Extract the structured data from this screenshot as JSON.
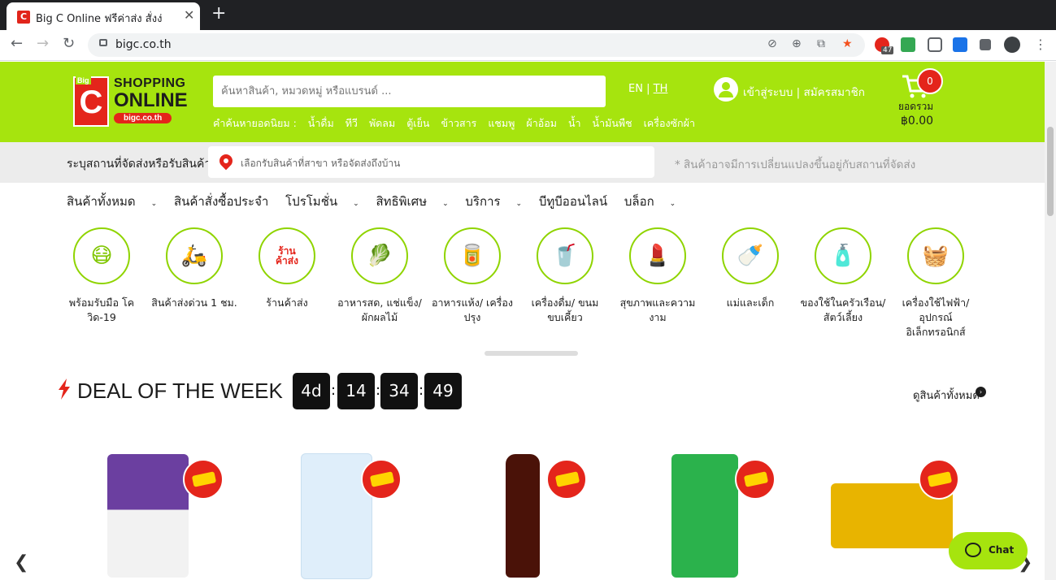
{
  "browser": {
    "tab_title": "Big C Online ฟรีค่าส่ง สั่งง่",
    "url": "bigc.co.th",
    "extension_badge": "47"
  },
  "header": {
    "logo": {
      "big": "Big",
      "c": "C",
      "line1": "SHOPPING",
      "line2": "ONLINE",
      "domain": "bigc.co.th"
    },
    "search_placeholder": "ค้นหาสินค้า, หมวดหมู่ หรือแบรนด์ ...",
    "popular_label": "คำค้นหายอดนิยม :",
    "popular_terms": [
      "น้ำดื่ม",
      "ทีวี",
      "พัดลม",
      "ตู้เย็น",
      "ข้าวสาร",
      "แชมพู",
      "ผ้าอ้อม",
      "น้ำ",
      "น้ำมันพืช",
      "เครื่องซักผ้า"
    ],
    "lang_en": "EN",
    "lang_sep": "|",
    "lang_th": "TH",
    "login": "เข้าสู่ระบบ",
    "login_sep": "|",
    "register": "สมัครสมาชิก",
    "cart_count": "0",
    "cart_label": "ยอดรวม",
    "cart_total": "฿0.00"
  },
  "location": {
    "label": "ระบุสถานที่จัดส่งหรือรับสินค้า",
    "placeholder": "เลือกรับสินค้าที่สาขา หรือจัดส่งถึงบ้าน",
    "note": "* สินค้าอาจมีการเปลี่ยนแปลงขึ้นอยู่กับสถานที่จัดส่ง"
  },
  "menu": [
    "สินค้าทั้งหมด",
    "สินค้าสั่งซื้อประจำ",
    "โปรโมชั่น",
    "สิทธิพิเศษ",
    "บริการ",
    "บีทูบีออนไลน์",
    "บล็อก"
  ],
  "categories": [
    {
      "label": "พร้อมรับมือ โควิด-19",
      "icon": "mask-icon"
    },
    {
      "label": "สินค้าส่งด่วน 1 ชม.",
      "icon": "scooter-icon"
    },
    {
      "label": "ร้านค้าส่ง",
      "icon": "wholesale-icon",
      "glyph": "ร้าน ค้าส่ง"
    },
    {
      "label": "อาหารสด, แช่แข็ง/ ผักผลไม้",
      "icon": "vegetable-icon"
    },
    {
      "label": "อาหารแห้ง/ เครื่องปรุง",
      "icon": "dry-food-icon"
    },
    {
      "label": "เครื่องดื่ม/ ขนมขบเคี้ยว",
      "icon": "drink-icon"
    },
    {
      "label": "สุขภาพและความงาม",
      "icon": "lipstick-icon"
    },
    {
      "label": "แม่และเด็ก",
      "icon": "baby-icon"
    },
    {
      "label": "ของใช้ในครัวเรือน/ สัตว์เลี้ยง",
      "icon": "household-icon"
    },
    {
      "label": "เครื่องใช้ไฟฟ้า/ อุปกรณ์อิเล็กทรอนิกส์",
      "icon": "appliance-icon"
    }
  ],
  "deal": {
    "title": "DEAL OF THE WEEK",
    "timer": [
      "4d",
      "14",
      "34",
      "49"
    ],
    "see_all": "ดูสินค้าทั้งหมด"
  },
  "products": [
    {
      "name": "rice-bag-product",
      "color": "#6b3fa0"
    },
    {
      "name": "kbs-sugar-product",
      "color": "#cfe3f5"
    },
    {
      "name": "sauce-bottle-product",
      "color": "#5a1a0e"
    },
    {
      "name": "zilk-tissue-product",
      "color": "#2bb24c"
    },
    {
      "name": "yumyum-noodle-product",
      "color": "#e8b400"
    }
  ],
  "chat_label": "Chat",
  "colors": {
    "brand_green": "#a6e40e",
    "brand_red": "#e4251b"
  }
}
